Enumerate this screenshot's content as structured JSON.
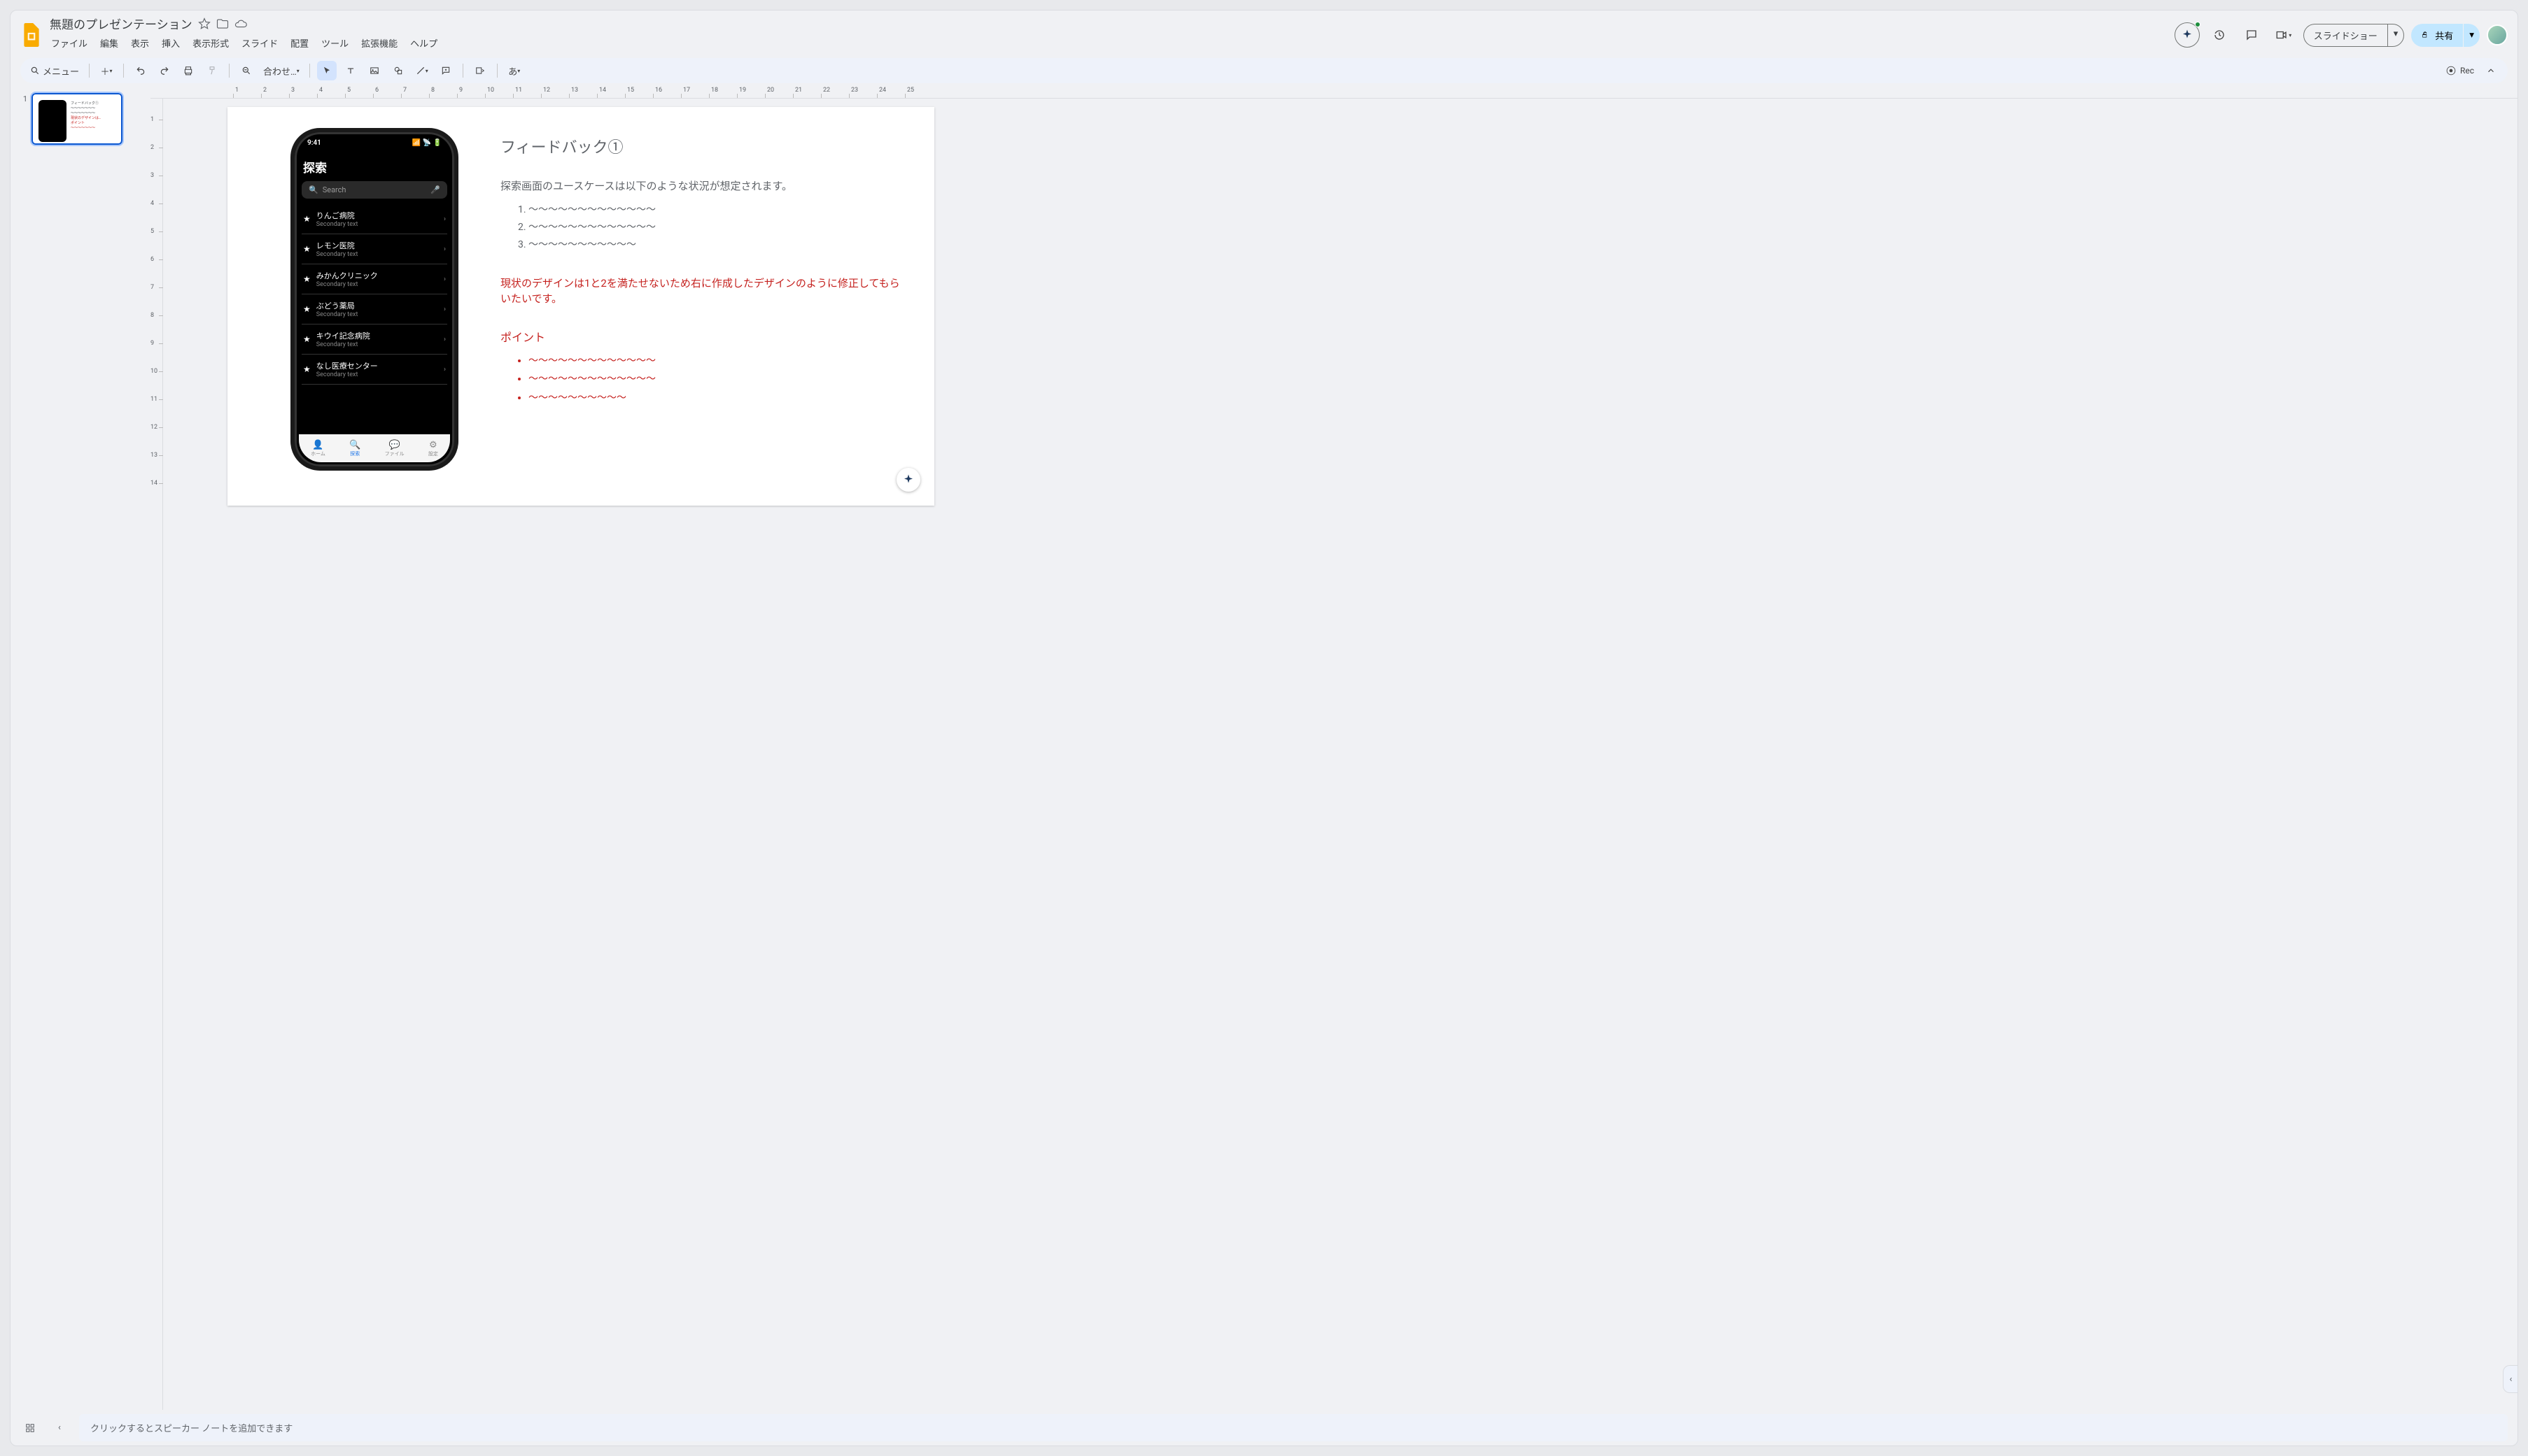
{
  "doc": {
    "title": "無題のプレゼンテーション"
  },
  "menus": [
    "ファイル",
    "編集",
    "表示",
    "挿入",
    "表示形式",
    "スライド",
    "配置",
    "ツール",
    "拡張機能",
    "ヘルプ"
  ],
  "toolbar": {
    "menu_label": "メニュー",
    "fit_label": "合わせ…",
    "input_lang": "あ",
    "rec_label": "Rec"
  },
  "actions": {
    "slideshow": "スライドショー",
    "share": "共有"
  },
  "thumb": {
    "number": "1",
    "thumb_title": "フィードバック①",
    "thumb_line": "〜〜〜〜〜〜〜",
    "thumb_red": "現状のデザインは…",
    "thumb_pts": "ポイント"
  },
  "slide": {
    "title": "フィードバック①",
    "intro": "探索画面のユースケースは以下のような状況が想定されます。",
    "list": [
      "〜〜〜〜〜〜〜〜〜〜〜〜〜",
      "〜〜〜〜〜〜〜〜〜〜〜〜〜",
      "〜〜〜〜〜〜〜〜〜〜〜"
    ],
    "red_para": "現状のデザインは1と2を満たせないため右に作成したデザインのように修正してもらいたいです。",
    "points_heading": "ポイント",
    "points": [
      "〜〜〜〜〜〜〜〜〜〜〜〜〜",
      "〜〜〜〜〜〜〜〜〜〜〜〜〜",
      "〜〜〜〜〜〜〜〜〜〜"
    ]
  },
  "phone": {
    "time": "9:41",
    "header": "探索",
    "search_placeholder": "Search",
    "secondary": "Secondary text",
    "rows": [
      "りんご病院",
      "レモン医院",
      "みかんクリニック",
      "ぶどう薬局",
      "キウイ記念病院",
      "なし医療センター"
    ],
    "tabs": [
      "ホーム",
      "探索",
      "ファイル",
      "設定"
    ]
  },
  "notes": {
    "placeholder": "クリックするとスピーカー ノートを追加できます"
  },
  "ruler_h": [
    1,
    2,
    3,
    4,
    5,
    6,
    7,
    8,
    9,
    10,
    11,
    12,
    13,
    14,
    15,
    16,
    17,
    18,
    19,
    20,
    21,
    22,
    23,
    24,
    25
  ],
  "ruler_v": [
    1,
    2,
    3,
    4,
    5,
    6,
    7,
    8,
    9,
    10,
    11,
    12,
    13,
    14
  ]
}
